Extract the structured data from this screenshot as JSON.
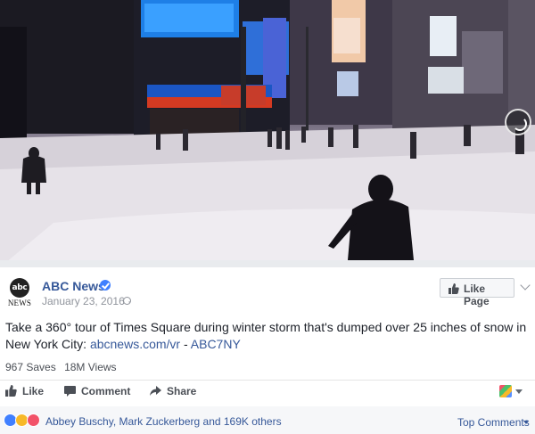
{
  "post": {
    "page_name": "ABC News",
    "logo_mark": "abc",
    "logo_word": "NEWS",
    "date": "January 23, 2016 ·",
    "like_page_label": "Like Page",
    "caption_text": "Take a 360° tour of Times Square during winter storm that's dumped over 25 inches of snow in New York City: ",
    "caption_link": "abcnews.com/vr",
    "caption_separator": " - ",
    "caption_tag": "ABC7NY"
  },
  "stats": {
    "saves": "967 Saves",
    "views": "18M Views"
  },
  "actions": {
    "like": "Like",
    "comment": "Comment",
    "share": "Share"
  },
  "reactions": {
    "summary": "Abbey Buschy, Mark Zuckerberg and 169K others",
    "top_comments": "Top Comments"
  },
  "icons": {
    "verified": "verified-badge-icon",
    "globe": "globe-icon",
    "thumbs_up": "thumbs-up-icon",
    "comment": "comment-bubble-icon",
    "share": "share-arrow-icon",
    "pano": "360-control-icon"
  },
  "colors": {
    "link_blue": "#365899",
    "verified_blue": "#4080ff",
    "text": "#1d2129",
    "muted": "#90949c"
  }
}
